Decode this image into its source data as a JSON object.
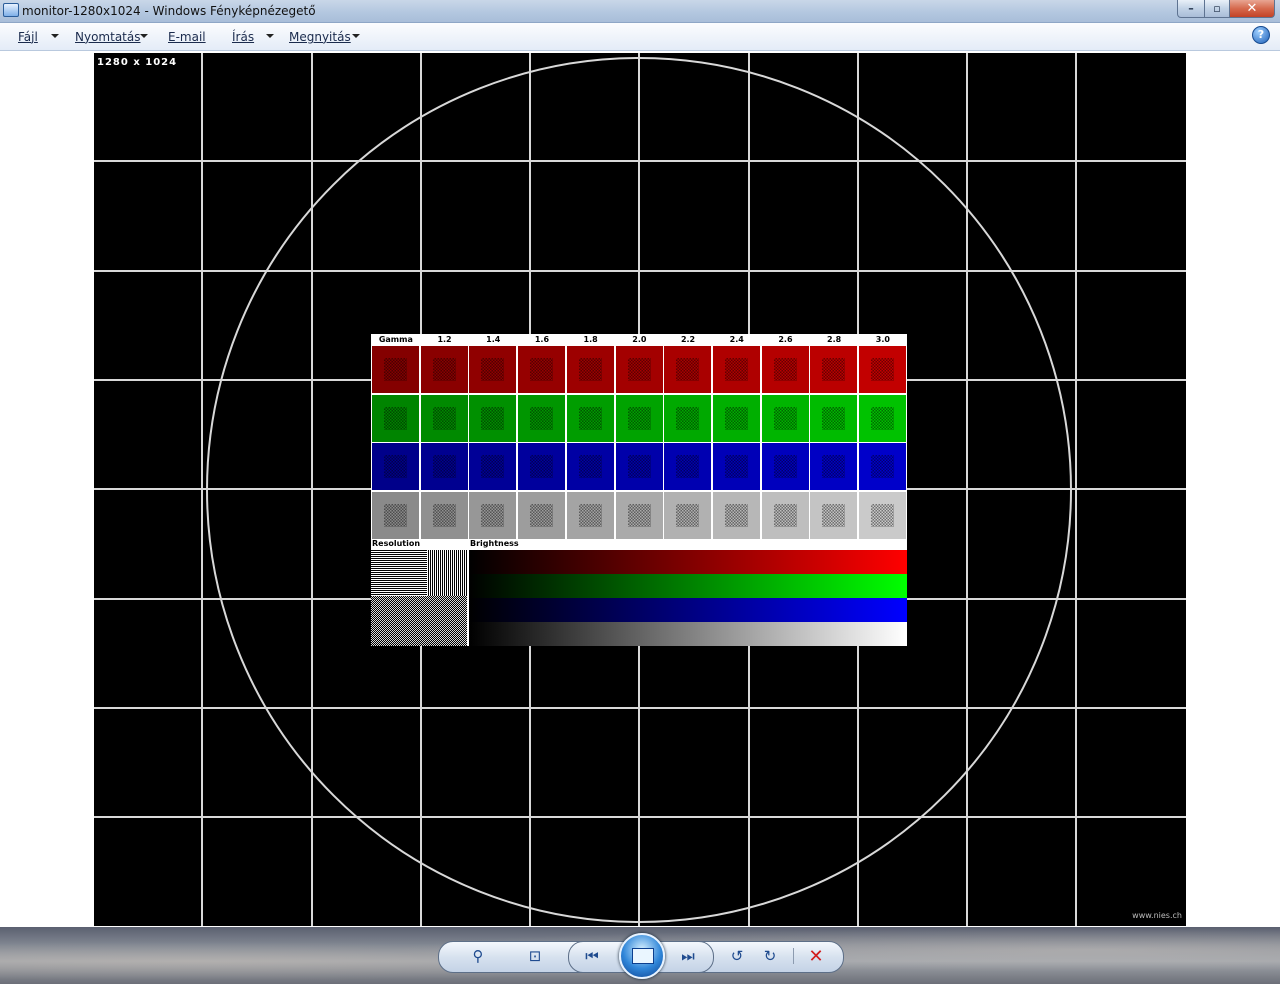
{
  "window": {
    "title": "monitor-1280x1024 - Windows Fényképnézegető",
    "minimize": "–",
    "maximize": "▫",
    "close": "✕"
  },
  "menu": {
    "items": [
      {
        "label": "Fájl"
      },
      {
        "label": "Nyomtatás"
      },
      {
        "label": "E-mail"
      },
      {
        "label": "Írás"
      },
      {
        "label": "Megnyitás"
      }
    ],
    "help": "?"
  },
  "image": {
    "resolution_label": "1280 x 1024",
    "watermark": "www.nies.ch",
    "chart": {
      "header": [
        "Gamma",
        "1.2",
        "1.4",
        "1.6",
        "1.8",
        "2.0",
        "2.2",
        "2.4",
        "2.6",
        "2.8",
        "3.0"
      ],
      "rows": [
        {
          "name": "red",
          "color": "#b00000"
        },
        {
          "name": "green",
          "color": "#00b000"
        },
        {
          "name": "blue",
          "color": "#0000b8"
        },
        {
          "name": "gray",
          "color": "#b8b8b8"
        }
      ],
      "resolution_label": "Resolution",
      "brightness_label": "Brightness",
      "brightness_bars": [
        {
          "name": "red",
          "color": "#ff0000"
        },
        {
          "name": "green",
          "color": "#00ff00"
        },
        {
          "name": "blue",
          "color": "#0000ff"
        },
        {
          "name": "white",
          "color": "#ffffff"
        }
      ]
    }
  },
  "toolbar": {
    "zoom": "⚲",
    "fit": "⊡",
    "previous": "⏮",
    "slideshow": "slideshow",
    "next": "⏭",
    "rotate_left": "↺",
    "rotate_right": "↻",
    "delete": "✕"
  }
}
